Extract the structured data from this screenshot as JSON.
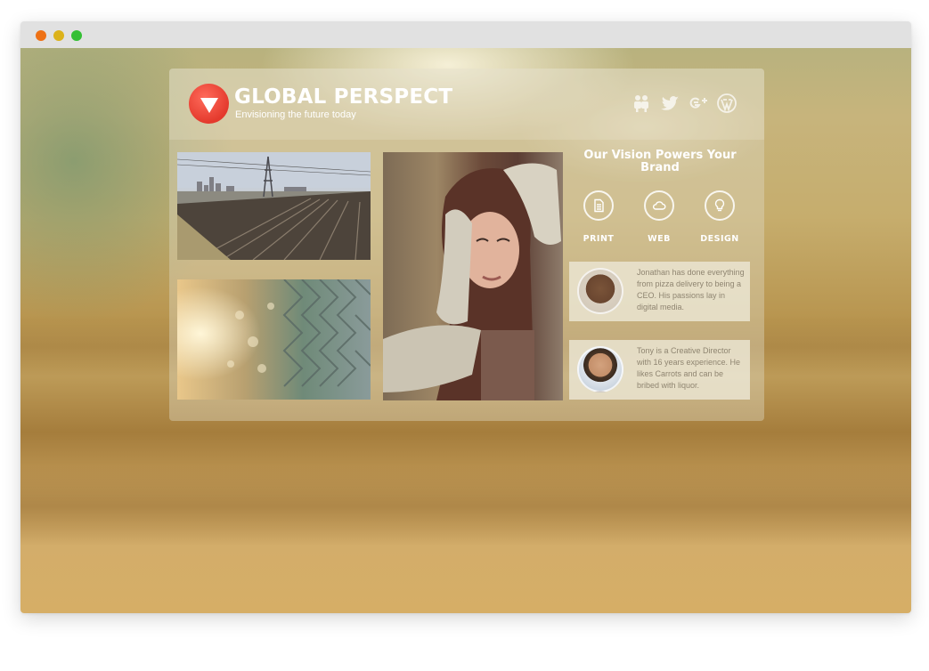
{
  "browser": {
    "window_buttons": [
      "close",
      "minimize",
      "maximize"
    ],
    "colors": {
      "close": "#ee7115",
      "minimize": "#dcb21a",
      "maximize": "#34bf34"
    }
  },
  "site": {
    "brand": "GLOBAL PERSPECT",
    "tagline": "Envisioning the future today",
    "logo_color": "#e43a2d",
    "social_icons": [
      "users-icon",
      "twitter-icon",
      "google-plus-icon",
      "wordpress-icon"
    ],
    "gallery": [
      "city-railyard-photo",
      "chain-link-fence-photo",
      "woman-portrait-photo"
    ],
    "vision": {
      "title": "Our Vision Powers Your Brand",
      "services": [
        {
          "label": "PRINT",
          "icon": "document-icon"
        },
        {
          "label": "WEB",
          "icon": "cloud-icon"
        },
        {
          "label": "DESIGN",
          "icon": "lightbulb-icon"
        }
      ]
    },
    "team": [
      {
        "bio": "Jonathan has done everything from pizza delivery to being a CEO. His passions lay in digital media."
      },
      {
        "bio": "Tony is a Creative Director with 16 years experience. He likes Carrots and can be bribed with liquor."
      }
    ]
  }
}
